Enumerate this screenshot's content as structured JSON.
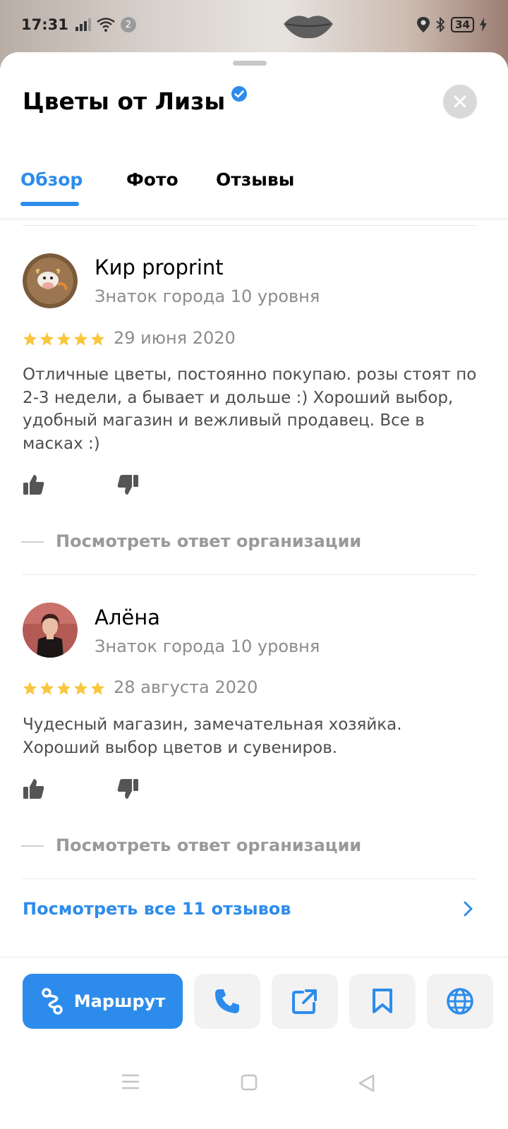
{
  "status_bar": {
    "time": "17:31",
    "notification_count": "2",
    "battery": "34"
  },
  "header": {
    "title": "Цветы от Лизы",
    "verified": true
  },
  "tabs": [
    {
      "label": "Обзор",
      "active": true
    },
    {
      "label": "Фото",
      "active": false
    },
    {
      "label": "Отзывы",
      "active": false
    }
  ],
  "reviews": [
    {
      "author": "Кир proprint",
      "level": "Знаток города 10 уровня",
      "rating": 5,
      "date": "29 июня 2020",
      "text": "Отличные цветы, постоянно покупаю. розы стоят по 2-3 недели, а бывает и дольше :) Хороший выбор, удобный магазин и вежливый продавец. Все в масках :)",
      "reply_link": "Посмотреть ответ организации"
    },
    {
      "author": "Алёна",
      "level": "Знаток города 10 уровня",
      "rating": 5,
      "date": "28 августа 2020",
      "text": "Чудесный магазин, замечательная хозяйка. Хороший выбор цветов и сувениров.",
      "reply_link": "Посмотреть ответ организации"
    }
  ],
  "all_reviews_link": "Посмотреть все 11 отзывов",
  "actions": {
    "route_label": "Маршрут",
    "buttons": [
      "phone-icon",
      "share-icon",
      "bookmark-icon",
      "globe-icon"
    ]
  },
  "colors": {
    "accent": "#2d8ceb",
    "star": "#f9c73e",
    "muted_text": "#8c8c8c"
  }
}
